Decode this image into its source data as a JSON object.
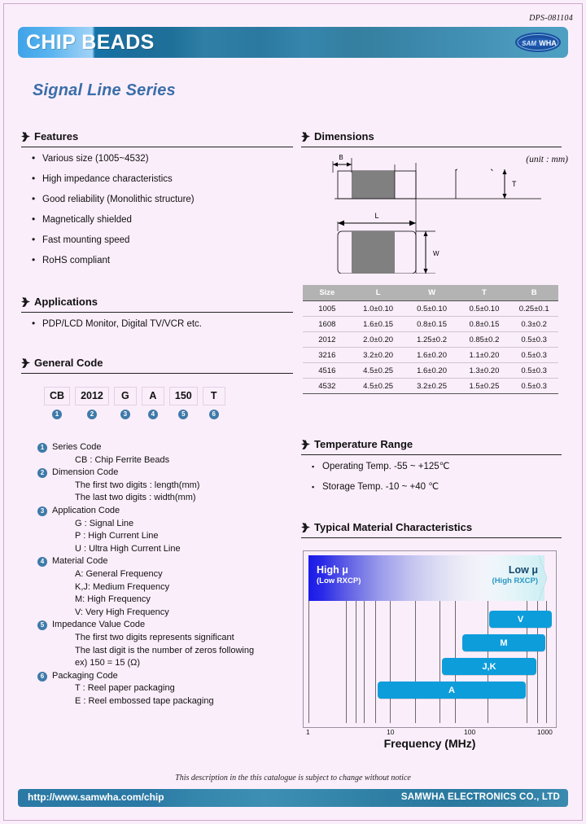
{
  "document": {
    "code": "DPS-081104",
    "header_title_part1": "CHIP",
    "header_title_part2": "BEADS",
    "logo_text": "SAMWHA",
    "series_title": "Signal Line Series"
  },
  "features": {
    "heading": "Features",
    "items": [
      "Various size (1005~4532)",
      "High impedance characteristics",
      "Good reliability (Monolithic structure)",
      "Magnetically shielded",
      "Fast mounting speed",
      "RoHS compliant"
    ]
  },
  "applications": {
    "heading": "Applications",
    "items": [
      "PDP/LCD Monitor, Digital TV/VCR etc."
    ]
  },
  "general_code": {
    "heading": "General Code",
    "boxes": [
      {
        "value": "CB",
        "num": "1"
      },
      {
        "value": "2012",
        "num": "2"
      },
      {
        "value": "G",
        "num": "3"
      },
      {
        "value": "A",
        "num": "4"
      },
      {
        "value": "150",
        "num": "5"
      },
      {
        "value": "T",
        "num": "6"
      }
    ],
    "legend": [
      {
        "num": "1",
        "label": "Series Code",
        "subs": [
          "CB : Chip Ferrite Beads"
        ]
      },
      {
        "num": "2",
        "label": "Dimension Code",
        "subs": [
          "The first two digits : length(mm)",
          "The last two digits : width(mm)"
        ]
      },
      {
        "num": "3",
        "label": "Application Code",
        "subs": [
          "G : Signal Line",
          "P : High Current Line",
          "U : Ultra High Current Line"
        ]
      },
      {
        "num": "4",
        "label": "Material Code",
        "subs": [
          "A: General Frequency",
          "K,J: Medium Frequency",
          "M: High Frequency",
          "V: Very High Frequency"
        ]
      },
      {
        "num": "5",
        "label": "Impedance Value Code",
        "subs": [
          "The first two digits represents significant",
          "The last digit is the number of zeros following",
          " ex) 150 = 15 (Ω)"
        ]
      },
      {
        "num": "6",
        "label": "Packaging Code",
        "subs": [
          "T : Reel paper packaging",
          "E : Reel embossed tape packaging"
        ]
      }
    ]
  },
  "dimensions": {
    "heading": "Dimensions",
    "unit_note": "(unit : mm)",
    "drawing_labels": {
      "b": "B",
      "l": "L",
      "w": "W",
      "t": "T"
    },
    "table": {
      "columns": [
        "Size",
        "L",
        "W",
        "T",
        "B"
      ],
      "rows": [
        [
          "1005",
          "1.0±0.10",
          "0.5±0.10",
          "0.5±0.10",
          "0.25±0.1"
        ],
        [
          "1608",
          "1.6±0.15",
          "0.8±0.15",
          "0.8±0.15",
          "0.3±0.2"
        ],
        [
          "2012",
          "2.0±0.20",
          "1.25±0.2",
          "0.85±0.2",
          "0.5±0.3"
        ],
        [
          "3216",
          "3.2±0.20",
          "1.6±0.20",
          "1.1±0.20",
          "0.5±0.3"
        ],
        [
          "4516",
          "4.5±0.25",
          "1.6±0.20",
          "1.3±0.20",
          "0.5±0.3"
        ],
        [
          "4532",
          "4.5±0.25",
          "3.2±0.25",
          "1.5±0.25",
          "0.5±0.3"
        ]
      ]
    }
  },
  "temperature": {
    "heading": "Temperature Range",
    "items": [
      "Operating Temp.  -55 ~ +125℃",
      "Storage Temp.  -10 ~ +40 ℃"
    ]
  },
  "material_chart": {
    "heading": "Typical Material Characteristics",
    "band_left_title": "High μ",
    "band_left_sub": "(Low RXCP)",
    "band_right_title": "Low μ",
    "band_right_sub": "(High RXCP)",
    "bar_color": "#0d9ddb"
  },
  "chart_data": {
    "type": "bar",
    "title": "Typical Material Characteristics",
    "xlabel": "Frequency (MHz)",
    "ylabel": "",
    "xscale": "log",
    "xlim": [
      1,
      1000
    ],
    "xticks": [
      1,
      10,
      100,
      1000
    ],
    "xtick_labels": [
      "1",
      "10",
      "100",
      "1000"
    ],
    "grid": true,
    "orientation": "horizontal",
    "categories": [
      "V",
      "M",
      "J,K",
      "A"
    ],
    "series": [
      {
        "name": "V",
        "label": "V",
        "x_start": 200,
        "x_end": 1000
      },
      {
        "name": "M",
        "label": "M",
        "x_start": 100,
        "x_end": 800
      },
      {
        "name": "J,K",
        "label": "J,K",
        "x_start": 50,
        "x_end": 600
      },
      {
        "name": "A",
        "label": "A",
        "x_start": 5,
        "x_end": 300
      }
    ],
    "gridline_values": [
      1,
      5,
      7,
      9,
      12,
      20,
      40,
      70,
      100,
      200,
      500,
      700,
      900
    ]
  },
  "footer": {
    "note": "This description in the this catalogue is subject to change without notice",
    "url": "http://www.samwha.com/chip",
    "company": "SAMWHA ELECTRONICS CO., LTD"
  }
}
